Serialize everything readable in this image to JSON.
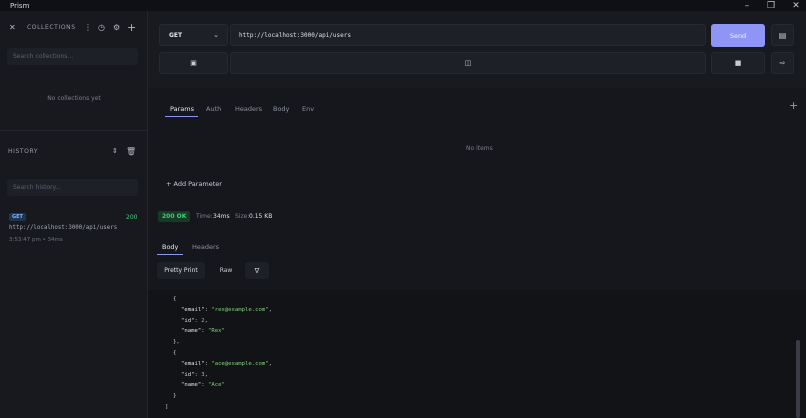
{
  "app": {
    "title": "Prism"
  },
  "sidebar": {
    "collections_label": "COLLECTIONS",
    "collections_search_placeholder": "Search collections...",
    "collections_empty": "No collections yet",
    "history_label": "HISTORY",
    "history_search_placeholder": "Search history...",
    "history_items": [
      {
        "method": "GET",
        "status": "200",
        "url": "http://localhost:3000/api/users",
        "meta": "3:53:47 pm • 34ms"
      }
    ]
  },
  "request": {
    "method": "GET",
    "url": "http://localhost:3000/api/users",
    "send_label": "Send"
  },
  "tabs": [
    "Params",
    "Auth",
    "Headers",
    "Body",
    "Env"
  ],
  "params": {
    "empty": "No items",
    "add_label": "+ Add Parameter"
  },
  "response": {
    "status": "200 OK",
    "time_label": "Time:",
    "time_value": "34ms",
    "size_label": "Size:",
    "size_value": "0.15 KB",
    "tabs": [
      "Body",
      "Headers"
    ],
    "view_modes": [
      "Pretty Print",
      "Raw"
    ],
    "body_lines": [
      {
        "indent": 0,
        "parts": [
          [
            "p",
            "{"
          ]
        ]
      },
      {
        "indent": 1,
        "parts": [
          [
            "k",
            "\"email\""
          ],
          [
            "p",
            ": "
          ],
          [
            "s",
            "\"rex@example.com\""
          ],
          [
            "p",
            ","
          ]
        ]
      },
      {
        "indent": 1,
        "parts": [
          [
            "k",
            "\"id\""
          ],
          [
            "p",
            ": "
          ],
          [
            "n",
            "2"
          ],
          [
            "p",
            ","
          ]
        ]
      },
      {
        "indent": 1,
        "parts": [
          [
            "k",
            "\"name\""
          ],
          [
            "p",
            ": "
          ],
          [
            "s",
            "\"Rex\""
          ]
        ]
      },
      {
        "indent": 0,
        "parts": [
          [
            "p",
            "},"
          ]
        ]
      },
      {
        "indent": 0,
        "parts": [
          [
            "p",
            "{"
          ]
        ]
      },
      {
        "indent": 1,
        "parts": [
          [
            "k",
            "\"email\""
          ],
          [
            "p",
            ": "
          ],
          [
            "s",
            "\"ace@example.com\""
          ],
          [
            "p",
            ","
          ]
        ]
      },
      {
        "indent": 1,
        "parts": [
          [
            "k",
            "\"id\""
          ],
          [
            "p",
            ": "
          ],
          [
            "n",
            "3"
          ],
          [
            "p",
            ","
          ]
        ]
      },
      {
        "indent": 1,
        "parts": [
          [
            "k",
            "\"name\""
          ],
          [
            "p",
            ": "
          ],
          [
            "s",
            "\"Ace\""
          ]
        ]
      },
      {
        "indent": 0,
        "parts": [
          [
            "p",
            "}"
          ]
        ]
      },
      {
        "indent": -1,
        "parts": [
          [
            "p",
            "]"
          ]
        ]
      }
    ]
  },
  "colors": {
    "accent": "#8f95f5",
    "status_ok": "#3fd17a",
    "background": "#15171c"
  },
  "icons": {
    "close": "close-icon",
    "menu": "more-vertical-icon",
    "history": "clock-icon",
    "settings": "gear-icon",
    "add": "plus-icon",
    "sort": "sort-icon",
    "trash": "trash-icon"
  }
}
